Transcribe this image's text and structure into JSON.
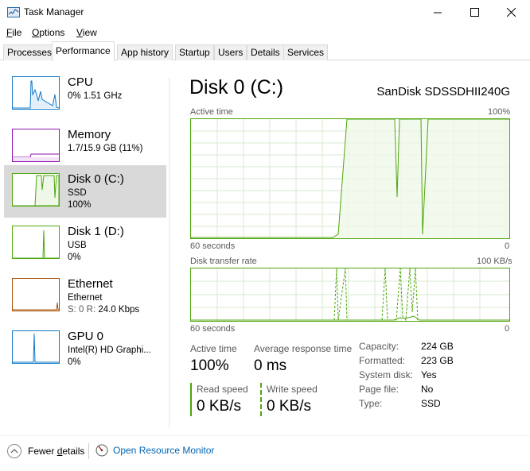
{
  "window": {
    "title": "Task Manager",
    "controls": {
      "minimize": "minimize-icon",
      "maximize": "maximize-icon",
      "close": "close-icon"
    }
  },
  "menu": [
    {
      "label": "File",
      "accel": "F",
      "rest": "ile"
    },
    {
      "label": "Options",
      "accel": "O",
      "rest": "ptions"
    },
    {
      "label": "View",
      "accel": "V",
      "rest": "iew"
    }
  ],
  "tabs": [
    "Processes",
    "Performance",
    "App history",
    "Startup",
    "Users",
    "Details",
    "Services"
  ],
  "active_tab": "Performance",
  "sidebar": [
    {
      "title": "CPU",
      "line2": "0%  1.51 GHz",
      "line3": "",
      "color": "#1179c6"
    },
    {
      "title": "Memory",
      "line2": "1.7/15.9 GB (11%)",
      "line3": "",
      "color": "#8b12ae"
    },
    {
      "title": "Disk 0 (C:)",
      "line2": "SSD",
      "line3": "100%",
      "color": "#4da60c",
      "selected": true
    },
    {
      "title": "Disk 1 (D:)",
      "line2": "USB",
      "line3": "0%",
      "color": "#4da60c"
    },
    {
      "title": "Ethernet",
      "line2": "Ethernet",
      "line3_prefix": "S: 0  R: ",
      "line3_value": "24.0 Kbps",
      "color": "#a74f01"
    },
    {
      "title": "GPU 0",
      "line2": "Intel(R) HD Graphi...",
      "line3": "0%",
      "color": "#1179c6"
    }
  ],
  "main": {
    "title": "Disk 0 (C:)",
    "model": "SanDisk SDSSDHII240G",
    "graph1": {
      "label": "Active time",
      "max_label": "100%",
      "time_label": "60 seconds",
      "min_label": "0"
    },
    "graph2": {
      "label": "Disk transfer rate",
      "max_label": "100 KB/s",
      "time_label": "60 seconds",
      "min_label": "0"
    },
    "stats": {
      "active_time": {
        "label": "Active time",
        "value": "100%"
      },
      "avg_response": {
        "label": "Average response time",
        "value": "0 ms"
      },
      "read_speed": {
        "label": "Read speed",
        "value": "0 KB/s"
      },
      "write_speed": {
        "label": "Write speed",
        "value": "0 KB/s"
      }
    },
    "properties": [
      {
        "key": "Capacity:",
        "value": "224 GB"
      },
      {
        "key": "Formatted:",
        "value": "223 GB"
      },
      {
        "key": "System disk:",
        "value": "Yes"
      },
      {
        "key": "Page file:",
        "value": "No"
      },
      {
        "key": "Type:",
        "value": "SSD"
      }
    ]
  },
  "footer": {
    "fewer_details": "Fewer details",
    "fewer_accel": "d",
    "open_resource_monitor": "Open Resource Monitor"
  },
  "colors": {
    "disk_green": "#4da60c",
    "disk_fill": "#eff7e8",
    "grid": "#d9ead0",
    "link": "#0066b4"
  }
}
